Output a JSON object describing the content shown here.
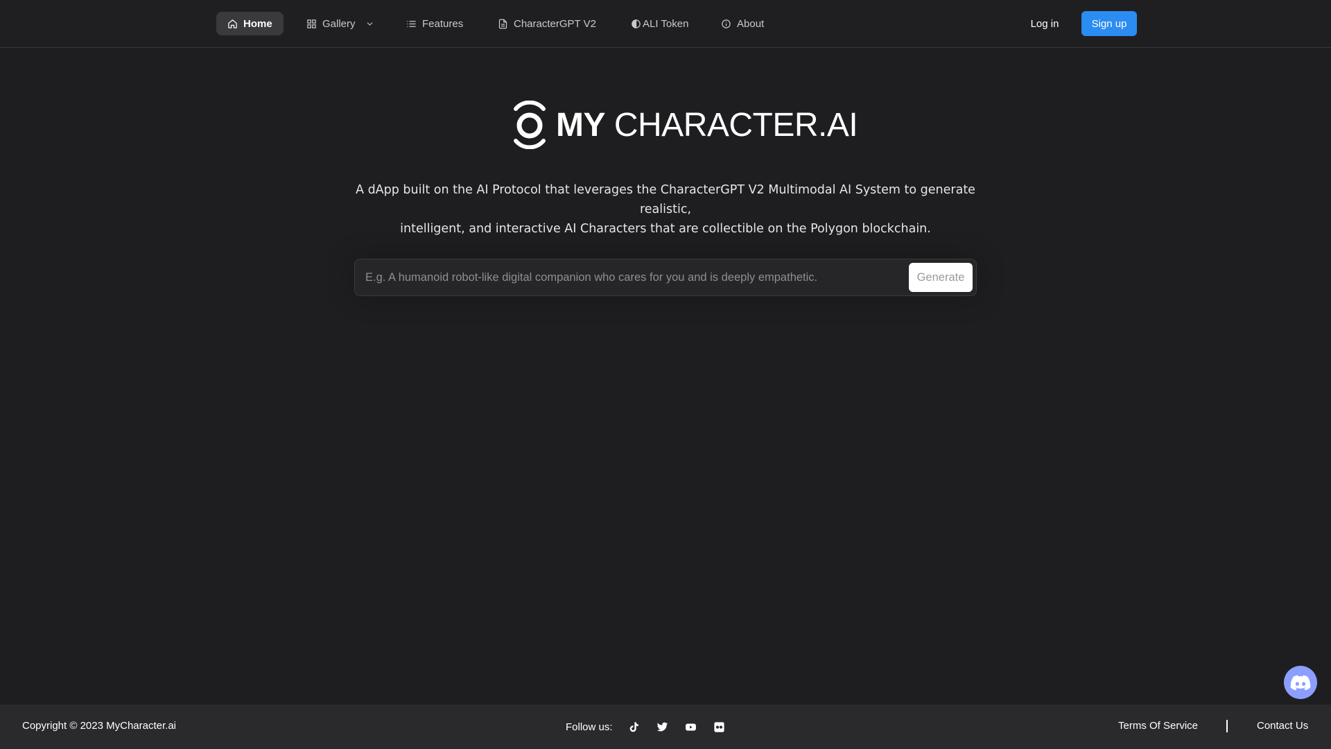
{
  "nav": {
    "items": [
      {
        "label": "Home",
        "icon": "home-icon",
        "active": true
      },
      {
        "label": "Gallery",
        "icon": "grid-icon",
        "dropdown": true
      },
      {
        "label": "Features",
        "icon": "list-icon"
      },
      {
        "label": "CharacterGPT V2",
        "icon": "document-icon"
      },
      {
        "label": "ALI Token",
        "icon": "half-circle-icon"
      },
      {
        "label": "About",
        "icon": "info-icon"
      }
    ],
    "login": "Log in",
    "signup": "Sign up"
  },
  "logo": {
    "bold": "MY",
    "rest": "CHARACTER.AI"
  },
  "description": {
    "line1": "A dApp built on the AI Protocol that leverages the CharacterGPT V2 Multimodal AI System to generate realistic,",
    "line2": "intelligent, and interactive AI Characters that are collectible on the Polygon blockchain."
  },
  "generate": {
    "placeholder": "E.g. A humanoid robot-like digital companion who cares for you and is deeply empathetic.",
    "value": "",
    "button": "Generate"
  },
  "footer": {
    "copyright": "Copyright © 2023 MyCharacter.ai",
    "follow_label": "Follow us:",
    "social": [
      "tiktok-icon",
      "twitter-icon",
      "youtube-icon",
      "flickr-icon"
    ],
    "terms": "Terms Of Service",
    "contact": "Contact Us"
  },
  "colors": {
    "background": "#1e1e20",
    "accent": "#2b8cf2",
    "discord": "#8c9eff"
  }
}
